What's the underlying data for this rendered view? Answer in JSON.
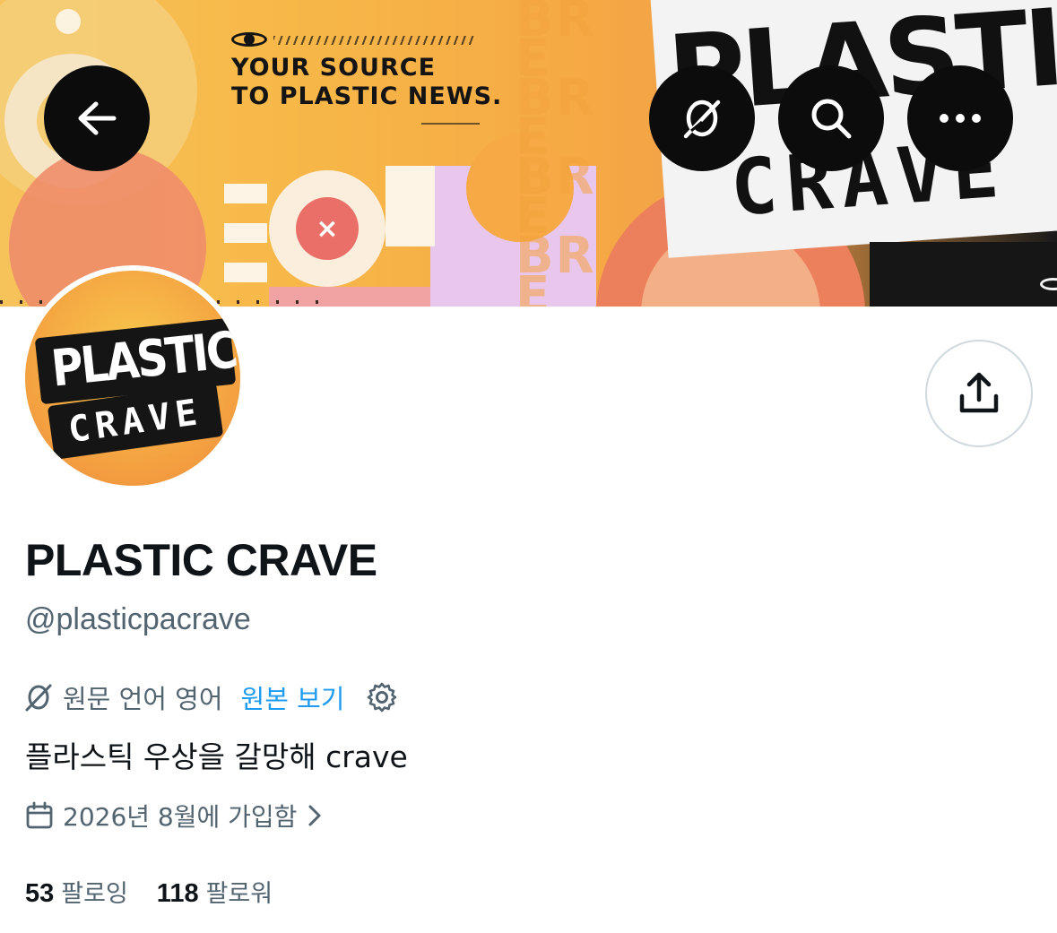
{
  "banner": {
    "headline_line1": "YOUR SOURCE",
    "headline_line2": "TO PLASTIC NEWS.",
    "ghost_text": "BRE BRE BRE BRE",
    "brand_word1": "PLASTI",
    "brand_word2": "CRAVE",
    "target_glyph": "×"
  },
  "header_actions": {
    "back_icon": "arrow-left-icon",
    "translate_icon": "no-translate-icon",
    "search_icon": "search-icon",
    "more_icon": "more-horizontal-icon"
  },
  "avatar": {
    "line1": "PLASTIC",
    "line2": "CRAVE"
  },
  "share": {
    "icon": "share-upload-icon"
  },
  "profile": {
    "display_name": "PLASTIC CRAVE",
    "handle": "@plasticpacrave",
    "translate_label": "원문 언어 영어",
    "translate_link": "원본 보기",
    "bio": "플라스틱 우상을 갈망해 crave",
    "joined": "2026년 8월에 가입함"
  },
  "stats": {
    "following_count": "53",
    "following_label": "팔로잉",
    "followers_count": "118",
    "followers_label": "팔로워"
  },
  "colors": {
    "text_primary": "#0f1419",
    "text_secondary": "#536471",
    "link": "#1d9bf0",
    "border": "#cfd9de"
  }
}
